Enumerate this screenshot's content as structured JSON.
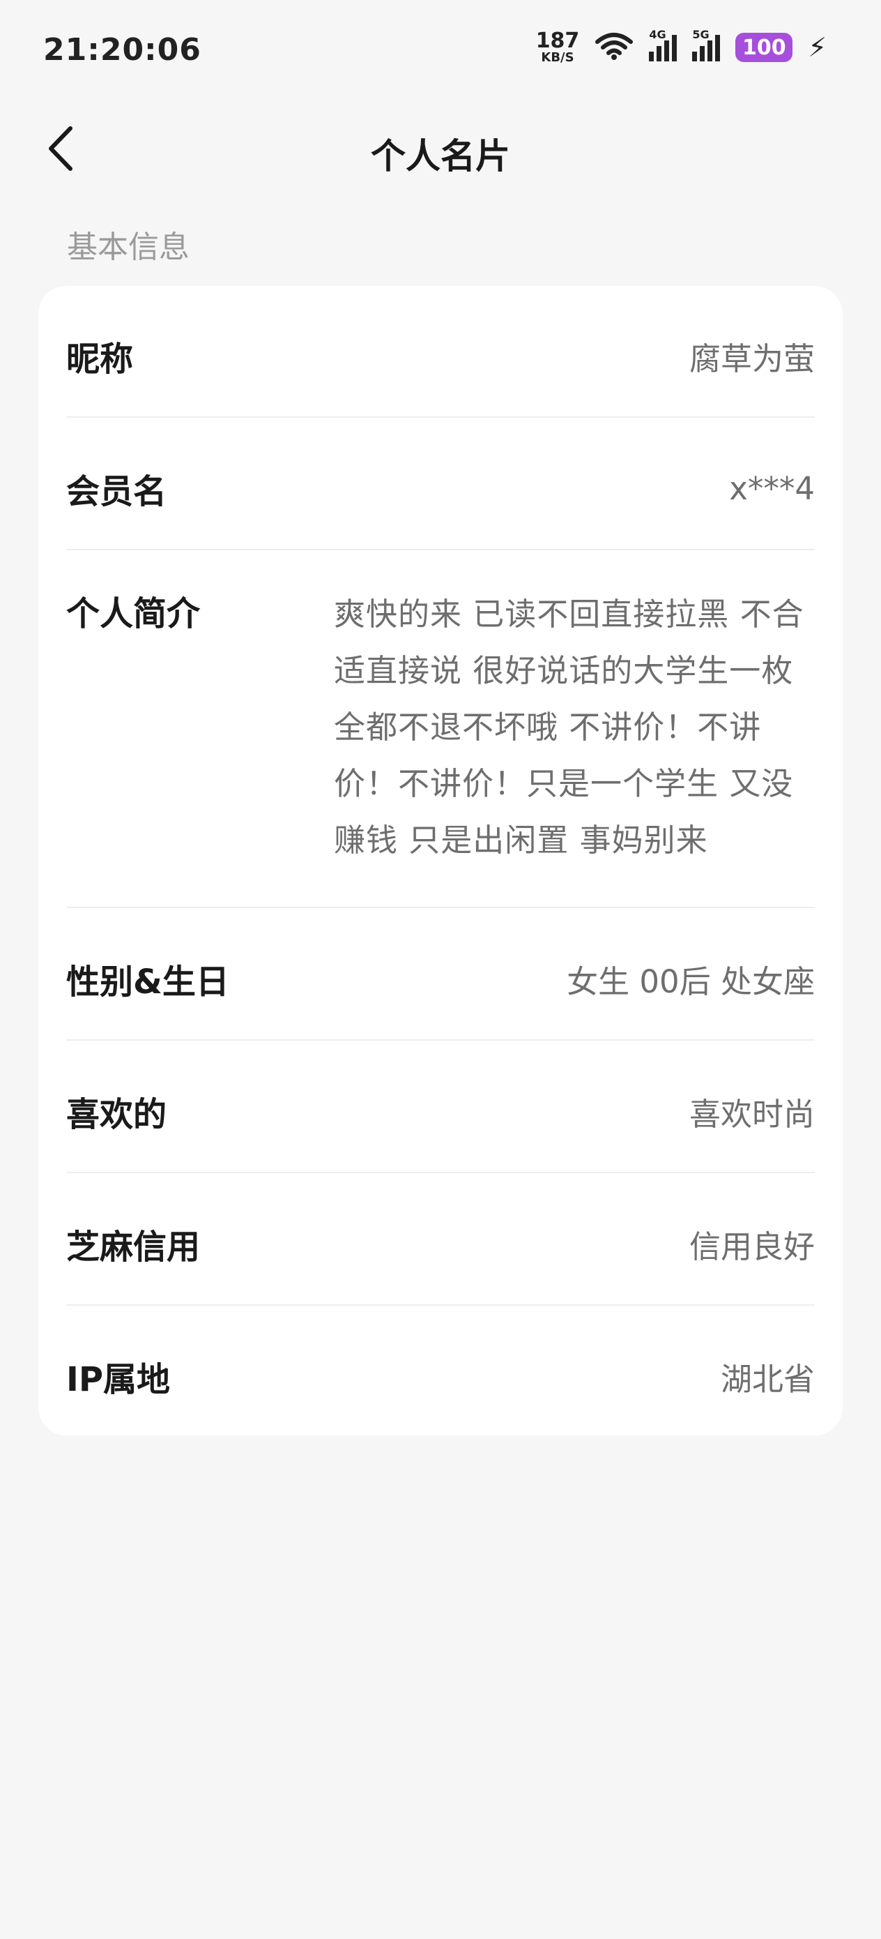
{
  "status_bar": {
    "time": "21:20:06",
    "net_speed_value": "187",
    "net_speed_unit": "KB/S",
    "signal_1_label": "4G",
    "signal_2_label": "5G",
    "battery": "100",
    "battery_color": "#a64fdc",
    "icons": [
      "wifi-icon",
      "signal-icon",
      "signal-icon",
      "charging-bolt-icon"
    ]
  },
  "header": {
    "back_icon": "chevron-left-icon",
    "title": "个人名片"
  },
  "section": {
    "label": "基本信息"
  },
  "profile": {
    "rows": [
      {
        "label": "昵称",
        "value": "腐草为萤"
      },
      {
        "label": "会员名",
        "value": "x***4"
      },
      {
        "label": "个人简介",
        "value": "爽快的来 已读不回直接拉黑 不合适直接说 很好说话的大学生一枚 全都不退不坏哦 不讲价！不讲价！不讲价！只是一个学生 又没赚钱 只是出闲置 事妈别来"
      },
      {
        "label": "性别&生日",
        "value": "女生 00后 处女座"
      },
      {
        "label": "喜欢的",
        "value": "喜欢时尚"
      },
      {
        "label": "芝麻信用",
        "value": "信用良好"
      },
      {
        "label": "IP属地",
        "value": "湖北省"
      }
    ]
  }
}
